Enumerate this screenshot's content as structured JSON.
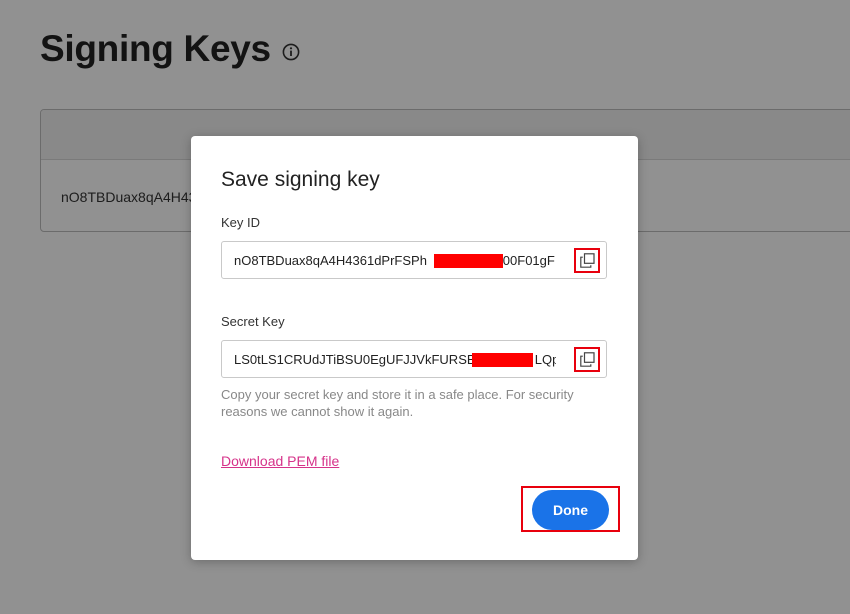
{
  "page": {
    "title": "Signing Keys",
    "info_icon": "info-circle-icon"
  },
  "table": {
    "rows": [
      {
        "key_id": "nO8TBDuax8qA4H43"
      }
    ]
  },
  "modal": {
    "title": "Save signing key",
    "key_id_label": "Key ID",
    "key_id_value_start": "nO8TBDuax8qA4H4361dPrFSPh",
    "key_id_value_end": "9I00F01gF",
    "secret_key_label": "Secret Key",
    "secret_key_value_start": "LS0tLS1CRUdJTiBSU0EgUFJJVkFURSBL",
    "secret_key_value_end": "LQpN",
    "help_text": "Copy your secret key and store it in a safe place. For security reasons we cannot show it again.",
    "download_label": "Download PEM file",
    "done_label": "Done",
    "copy_icon": "copy-icon"
  },
  "colors": {
    "accent": "#1a73e8",
    "link": "#d6338a",
    "highlight": "#e8000d",
    "redaction": "#ff0000"
  }
}
